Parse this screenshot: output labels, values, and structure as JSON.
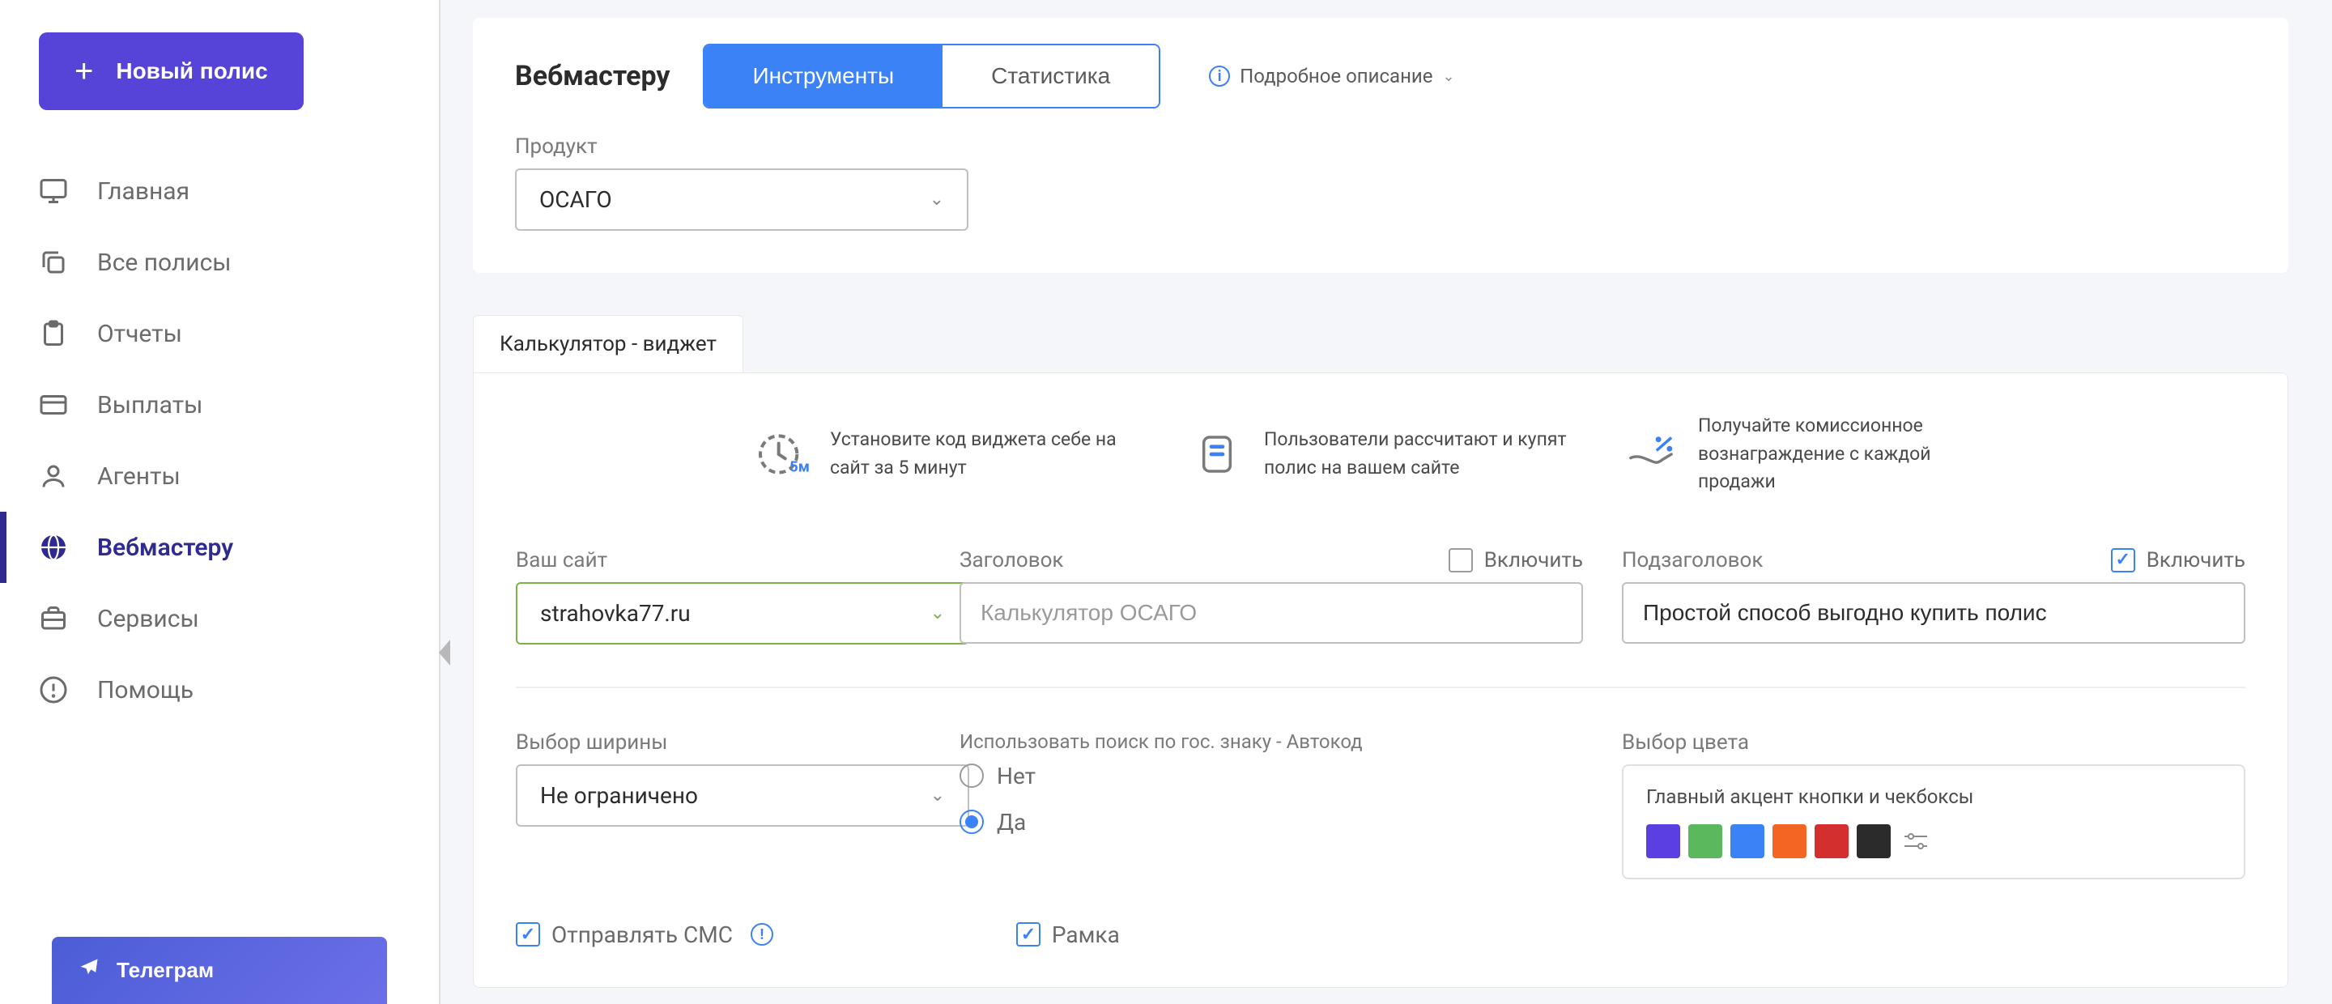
{
  "sidebar": {
    "new_policy": "Новый полис",
    "items": [
      {
        "label": "Главная"
      },
      {
        "label": "Все полисы"
      },
      {
        "label": "Отчеты"
      },
      {
        "label": "Выплаты"
      },
      {
        "label": "Агенты"
      },
      {
        "label": "Вебмастеру"
      },
      {
        "label": "Сервисы"
      },
      {
        "label": "Помощь"
      }
    ],
    "telegram": "Телеграм"
  },
  "header": {
    "title": "Вебмастеру",
    "tab_tools": "Инструменты",
    "tab_stats": "Статистика",
    "desc_link": "Подробное описание",
    "product_label": "Продукт",
    "product_value": "ОСАГО"
  },
  "widget": {
    "section_tab": "Калькулятор - виджет",
    "info1": "Установите код виджета себе на сайт за 5 минут",
    "info1_badge": "5м.",
    "info2": "Пользователи рассчитают и купят полис на вашем сайте",
    "info3": "Получайте комиссионное вознаграждение с каждой продажи",
    "site_label": "Ваш сайт",
    "site_value": "strahovka77.ru",
    "title_label": "Заголовок",
    "title_placeholder": "Калькулятор ОСАГО",
    "title_enable": "Включить",
    "subtitle_label": "Подзаголовок",
    "subtitle_value": "Простой способ выгодно купить полис",
    "subtitle_enable": "Включить",
    "width_label": "Выбор ширины",
    "width_value": "Не ограничено",
    "autocode_label": "Использовать поиск по гос. знаку - Автокод",
    "radio_no": "Нет",
    "radio_yes": "Да",
    "color_label": "Выбор цвета",
    "color_panel_title": "Главный акцент кнопки и чекбоксы",
    "colors": [
      "#5b3fe0",
      "#5cb85c",
      "#3b82f6",
      "#f26522",
      "#d32f2f",
      "#2b2b2b"
    ],
    "send_sms": "Отправлять СМС",
    "frame": "Рамка"
  }
}
